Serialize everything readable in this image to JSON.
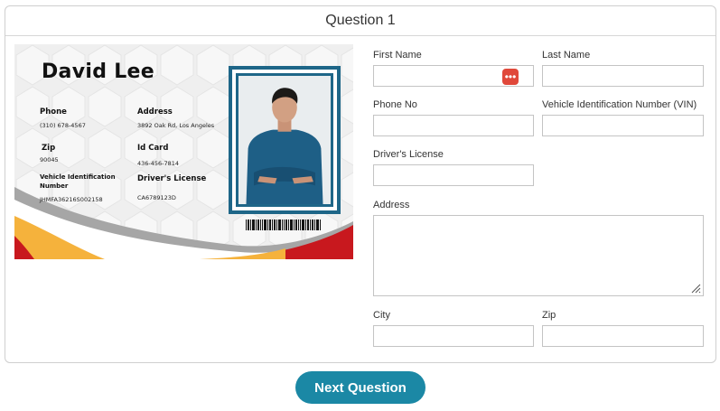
{
  "header": {
    "title": "Question 1"
  },
  "id_card": {
    "name": "David Lee",
    "phone_label": "Phone",
    "phone_value": "(310) 678-4567",
    "address_label": "Address",
    "address_value": "3892 Oak Rd, Los Angeles",
    "zip_label": "Zip",
    "zip_value": "90045",
    "idcard_label": "Id Card",
    "idcard_value": "436-456-7814",
    "vin_label_line1": "Vehicle Identification",
    "vin_label_line2": "Number",
    "vin_value": "JHMFA36216S002158",
    "license_label": "Driver's License",
    "license_value": "CA6789123D",
    "accent_colors": {
      "red": "#c8181e",
      "yellow": "#f5b23c",
      "gray": "#a0a0a0",
      "frame": "#1e6688"
    }
  },
  "form": {
    "first_name_label": "First Name",
    "first_name_value": "",
    "last_name_label": "Last Name",
    "last_name_value": "",
    "phone_label": "Phone No",
    "phone_value": "",
    "vin_label": "Vehicle Identification Number (VIN)",
    "vin_value": "",
    "license_label": "Driver's License",
    "license_value": "",
    "address_label": "Address",
    "address_value": "",
    "city_label": "City",
    "city_value": "",
    "zip_label": "Zip",
    "zip_value": "",
    "autofill_icon": "more-dots-icon",
    "autofill_icon_text": "•••"
  },
  "footer": {
    "next_label": "Next Question",
    "button_color": "#1b88a5"
  }
}
